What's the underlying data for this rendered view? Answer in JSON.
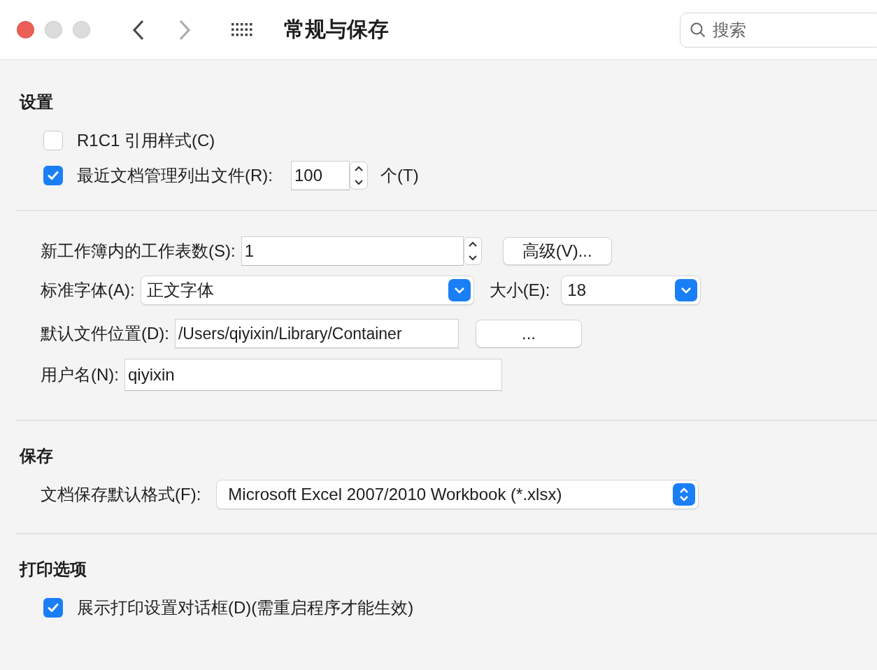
{
  "window": {
    "title": "常规与保存"
  },
  "search": {
    "placeholder": "搜索"
  },
  "settings": {
    "title": "设置",
    "options": [
      {
        "label": "R1C1 引用样式(C)",
        "checked": false
      },
      {
        "label": "最近文档管理列出文件(R):",
        "checked": true,
        "value": "100",
        "suffix": "个(T)"
      }
    ]
  },
  "general": {
    "sheets": {
      "label": "新工作簿内的工作表数(S):",
      "value": "1",
      "button": "高级(V)..."
    },
    "font": {
      "label": "标准字体(A):",
      "value": "正文字体",
      "size_label": "大小(E):",
      "size_value": "18"
    },
    "location": {
      "label": "默认文件位置(D):",
      "value": "/Users/qiyixin/Library/Container",
      "button": "..."
    },
    "username": {
      "label": "用户名(N):",
      "value": "qiyixin"
    }
  },
  "save": {
    "title": "保存",
    "format": {
      "label": "文档保存默认格式(F):",
      "value": "Microsoft Excel 2007/2010 Workbook (*.xlsx)"
    }
  },
  "print": {
    "title": "打印选项",
    "options": [
      {
        "label": "展示打印设置对话框(D)(需重启程序才能生效)",
        "checked": true
      }
    ]
  }
}
